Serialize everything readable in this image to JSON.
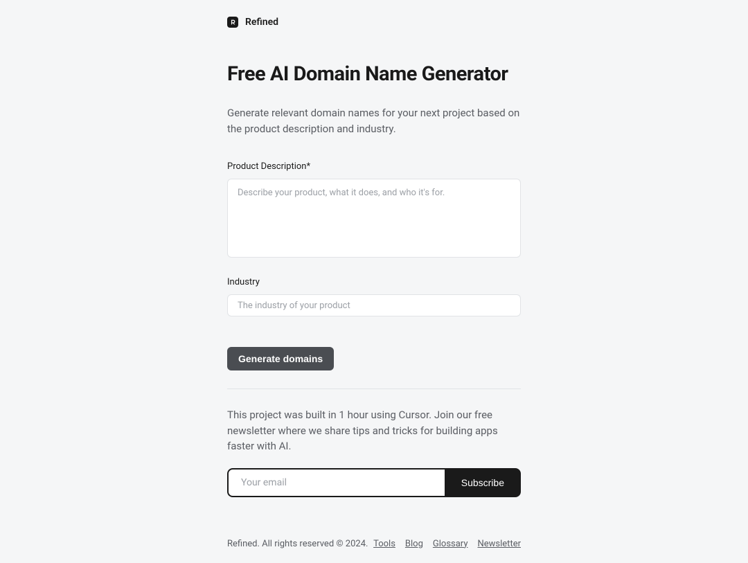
{
  "header": {
    "brand_name": "Refined"
  },
  "main": {
    "title": "Free AI Domain Name Generator",
    "subtitle": "Generate relevant domain names for your next project based on the product description and industry.",
    "form": {
      "description_label": "Product Description*",
      "description_placeholder": "Describe your product, what it does, and who it's for.",
      "industry_label": "Industry",
      "industry_placeholder": "The industry of your product",
      "generate_button": "Generate domains"
    },
    "newsletter": {
      "text": "This project was built in 1 hour using Cursor. Join our free newsletter where we share tips and tricks for building apps faster with AI.",
      "email_placeholder": "Your email",
      "subscribe_button": "Subscribe"
    }
  },
  "footer": {
    "copyright": "Refined. All rights reserved © 2024.",
    "links": [
      "Tools",
      "Blog",
      "Glossary",
      "Newsletter"
    ]
  }
}
